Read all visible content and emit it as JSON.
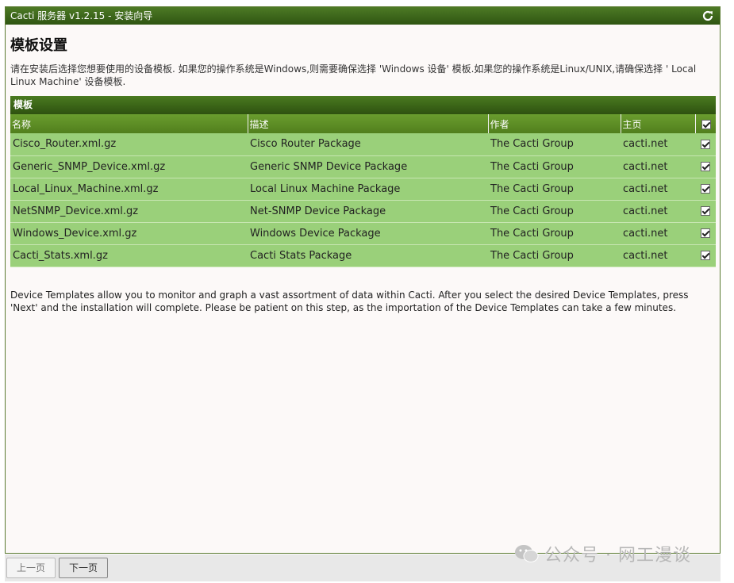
{
  "window": {
    "title": "Cacti 服务器 v1.2.15 - 安装向导"
  },
  "page": {
    "heading": "模板设置",
    "intro": "请在安装后选择您想要使用的设备模板. 如果您的操作系统是Windows,则需要确保选择 'Windows 设备' 模板.如果您的操作系统是Linux/UNIX,请确保选择 ' Local Linux Machine' 设备模板.",
    "note": "Device Templates allow you to monitor and graph a vast assortment of data within Cacti. After you select the desired Device Templates, press 'Next' and the installation will complete. Please be patient on this step, as the importation of the Device Templates can take a few minutes."
  },
  "table": {
    "section_title": "模板",
    "columns": [
      "名称",
      "描述",
      "作者",
      "主页"
    ],
    "rows": [
      {
        "name": "Cisco_Router.xml.gz",
        "desc": "Cisco Router Package",
        "author": "The Cacti Group",
        "home": "cacti.net",
        "checked": true
      },
      {
        "name": "Generic_SNMP_Device.xml.gz",
        "desc": "Generic SNMP Device Package",
        "author": "The Cacti Group",
        "home": "cacti.net",
        "checked": true
      },
      {
        "name": "Local_Linux_Machine.xml.gz",
        "desc": "Local Linux Machine Package",
        "author": "The Cacti Group",
        "home": "cacti.net",
        "checked": true
      },
      {
        "name": "NetSNMP_Device.xml.gz",
        "desc": "Net-SNMP Device Package",
        "author": "The Cacti Group",
        "home": "cacti.net",
        "checked": true
      },
      {
        "name": "Windows_Device.xml.gz",
        "desc": "Windows Device Package",
        "author": "The Cacti Group",
        "home": "cacti.net",
        "checked": true
      },
      {
        "name": "Cacti_Stats.xml.gz",
        "desc": "Cacti Stats Package",
        "author": "The Cacti Group",
        "home": "cacti.net",
        "checked": true
      }
    ]
  },
  "buttons": {
    "prev": "上一页",
    "next": "下一页"
  },
  "watermark": "公众号 · 网工漫谈",
  "colors": {
    "header_dark": "#2e5210",
    "header_mid": "#517f1d",
    "row_green": "#9ad07a"
  }
}
